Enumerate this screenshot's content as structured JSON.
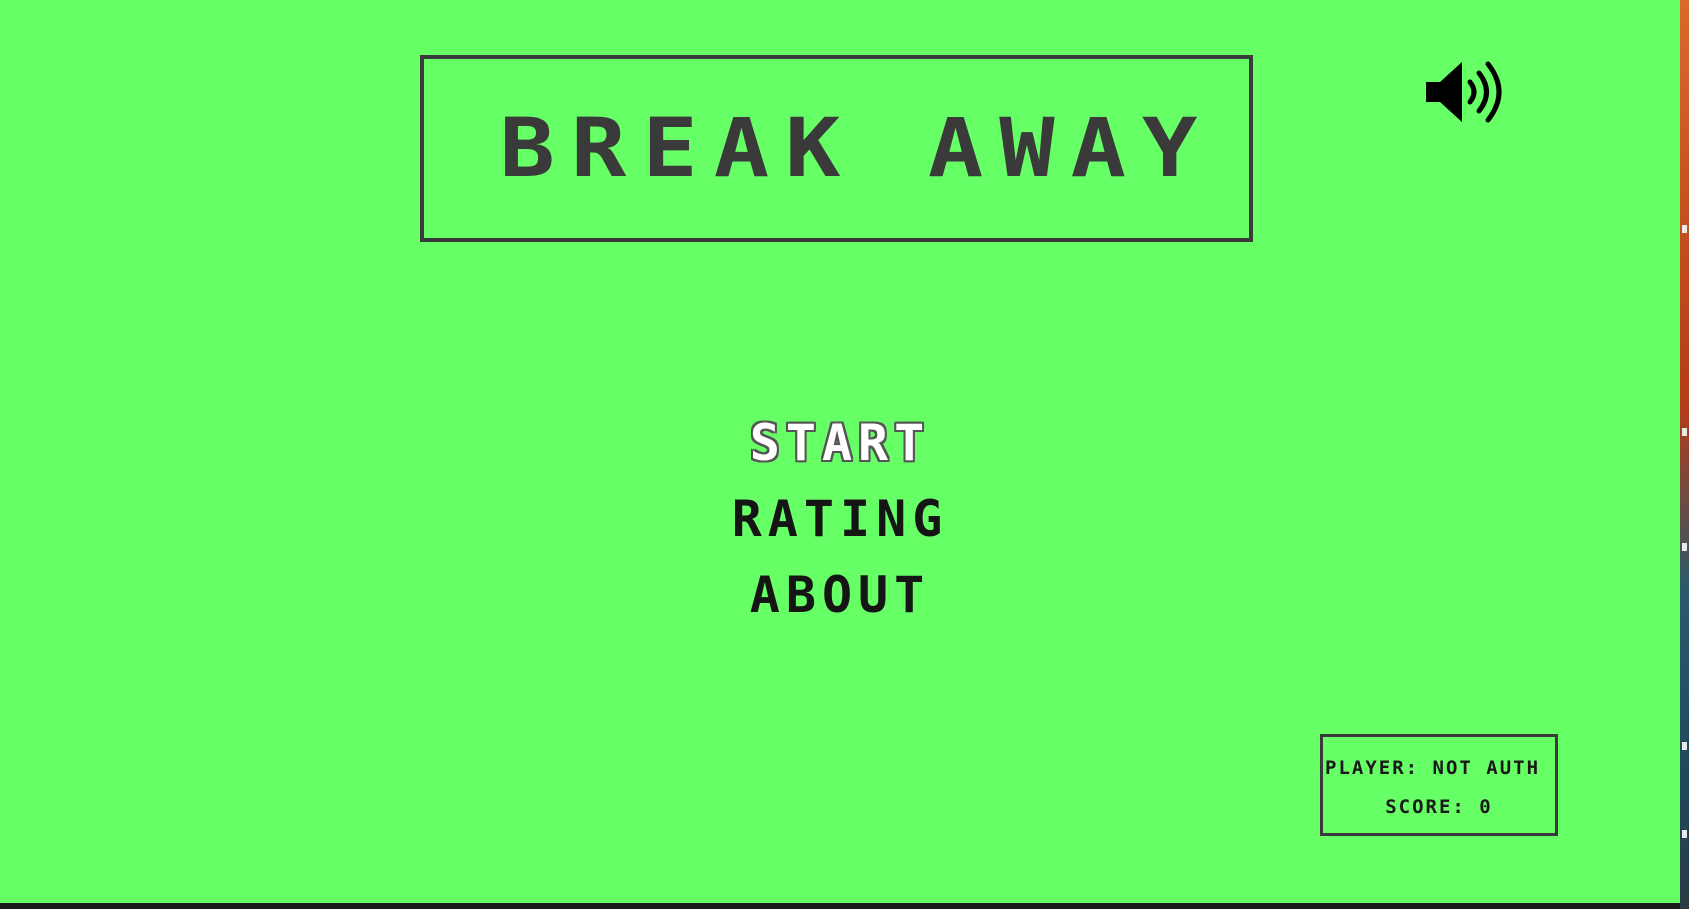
{
  "game": {
    "title": "BREAK AWAY",
    "background_color": "#66ff66",
    "ink_color": "#3a3a3a"
  },
  "sound": {
    "icon": "speaker-volume-icon",
    "state": "on"
  },
  "menu": {
    "items": [
      {
        "label": "START",
        "selected": true
      },
      {
        "label": "RATING",
        "selected": false
      },
      {
        "label": "ABOUT",
        "selected": false
      }
    ]
  },
  "status": {
    "player_line": "PLAYER: NOT AUTH",
    "score_line": "SCORE: 0"
  }
}
